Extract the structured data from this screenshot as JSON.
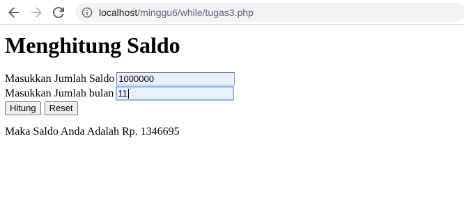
{
  "browser": {
    "url_host": "localhost",
    "url_path": "/minggu6/while/tugas3.php"
  },
  "page": {
    "title": "Menghitung Saldo",
    "form": {
      "saldo_label": "Masukkan Jumlah Saldo",
      "saldo_value": "1000000",
      "bulan_label": "Masukkan Jumlah bulan",
      "bulan_value": "11",
      "hitung_label": "Hitung",
      "reset_label": "Reset"
    },
    "result_text": "Maka Saldo Anda Adalah Rp. 1346695"
  },
  "colors": {
    "autofill_background": "#e8f0fe",
    "focus_ring": "#8ab4f8",
    "omnibox_background": "#f1f3f4"
  },
  "icons": [
    "back-arrow-icon",
    "forward-arrow-icon",
    "reload-icon",
    "info-icon"
  ]
}
